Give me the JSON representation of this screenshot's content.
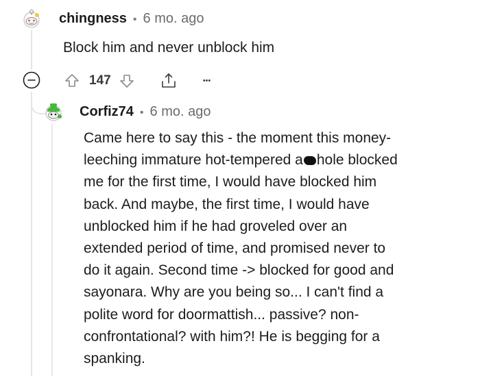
{
  "comment": {
    "username": "chingness",
    "separator": "•",
    "time": "6 mo. ago",
    "body": "Block him and never unblock him",
    "score": "147",
    "more_label": "•••"
  },
  "reply": {
    "username": "Corfiz74",
    "separator": "•",
    "time": "6 mo. ago",
    "lines": [
      [
        "Came here to say this - the moment this money-"
      ],
      [
        "leeching immature hot-tempered a",
        "hole blocked"
      ],
      [
        "me for the first time, I would have blocked him"
      ],
      [
        "back. And maybe, the first time, I would have"
      ],
      [
        "unblocked him if he had groveled over an"
      ],
      [
        "extended period of time, and promised never to"
      ],
      [
        "do it again. Second time -> blocked for good and"
      ],
      [
        "sayonara. Why are you being so... I can't find a"
      ],
      [
        "polite word for doormattish... passive? non-"
      ],
      [
        "confrontational? with him?! He is begging for a"
      ],
      [
        "spanking."
      ]
    ]
  },
  "colors": {
    "thread_line": "#e4e6e8",
    "icon_gray": "#8a8a8a",
    "reply_avatar_green": "#46b83c"
  }
}
